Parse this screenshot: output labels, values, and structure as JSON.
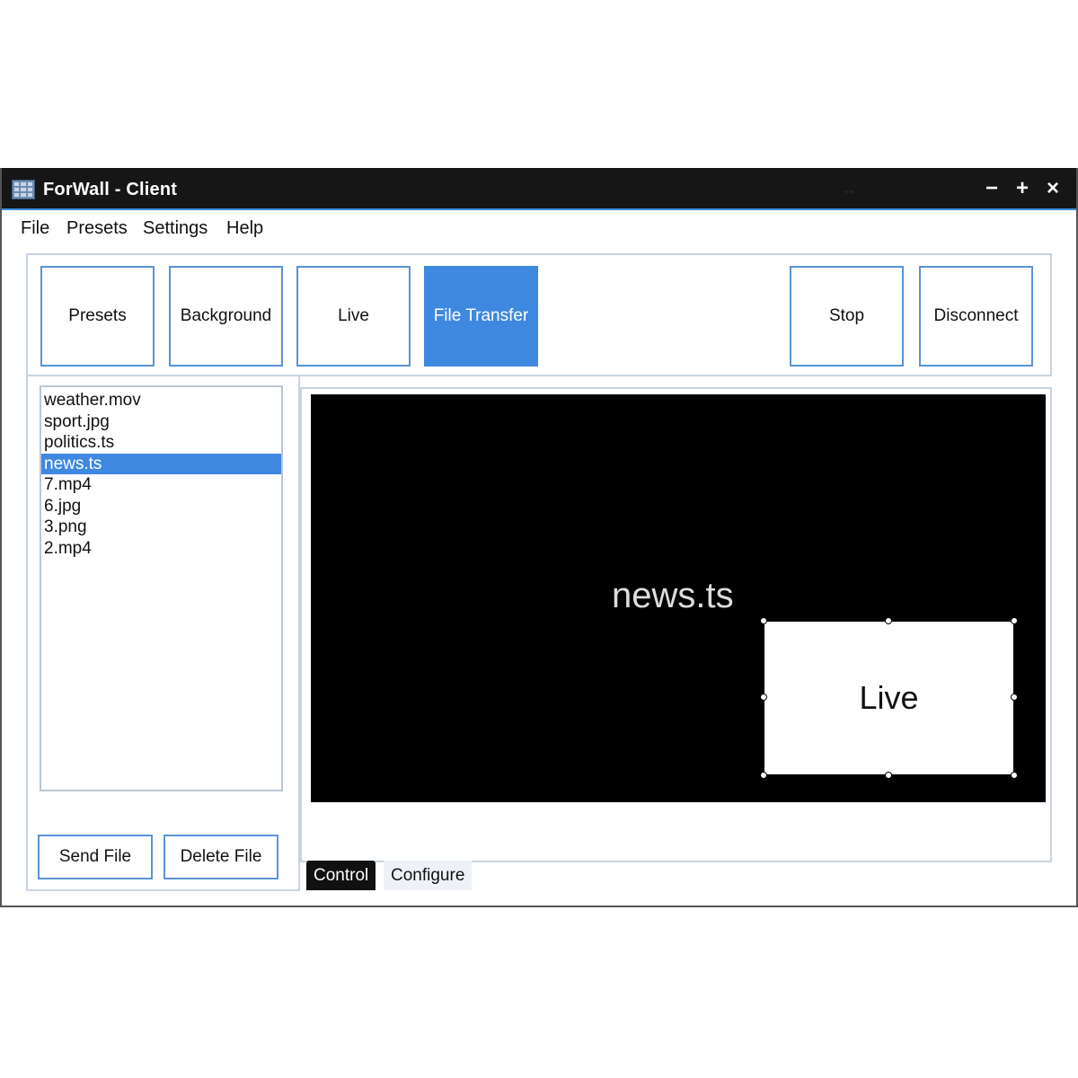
{
  "window": {
    "title": "ForWall - Client",
    "controls": {
      "minimize": "−",
      "maximize": "+",
      "close": "×"
    },
    "resize_glyph": "↔"
  },
  "menu": [
    "File",
    "Presets",
    "Settings",
    "Help"
  ],
  "toolbar": {
    "presets": "Presets",
    "background": "Background",
    "live": "Live",
    "file_transfer": "File Transfer",
    "stop": "Stop",
    "disconnect": "Disconnect",
    "active": "File Transfer"
  },
  "files": [
    "weather.mov",
    "sport.jpg",
    "politics.ts",
    "news.ts",
    "7.mp4",
    "6.jpg",
    "3.png",
    "2.mp4"
  ],
  "selected_file": "news.ts",
  "file_actions": {
    "send": "Send File",
    "delete": "Delete File"
  },
  "preview": {
    "main_label": "news.ts",
    "overlay_label": "Live"
  },
  "tabs": {
    "control": "Control",
    "configure": "Configure",
    "active": "Control"
  },
  "colors": {
    "accent": "#3f88e0",
    "titlebar": "#161616",
    "preview_bg": "#000000"
  }
}
